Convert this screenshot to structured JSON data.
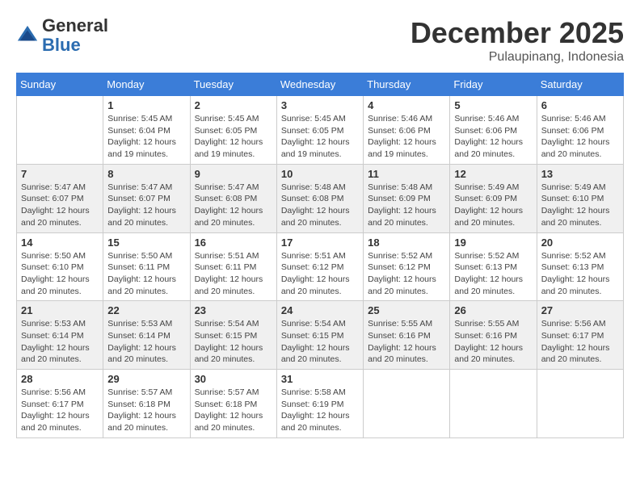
{
  "header": {
    "logo_general": "General",
    "logo_blue": "Blue",
    "month_title": "December 2025",
    "location": "Pulaupinang, Indonesia"
  },
  "days_of_week": [
    "Sunday",
    "Monday",
    "Tuesday",
    "Wednesday",
    "Thursday",
    "Friday",
    "Saturday"
  ],
  "weeks": [
    [
      {
        "day": "",
        "sunrise": "",
        "sunset": "",
        "daylight": ""
      },
      {
        "day": "1",
        "sunrise": "Sunrise: 5:45 AM",
        "sunset": "Sunset: 6:04 PM",
        "daylight": "Daylight: 12 hours and 19 minutes."
      },
      {
        "day": "2",
        "sunrise": "Sunrise: 5:45 AM",
        "sunset": "Sunset: 6:05 PM",
        "daylight": "Daylight: 12 hours and 19 minutes."
      },
      {
        "day": "3",
        "sunrise": "Sunrise: 5:45 AM",
        "sunset": "Sunset: 6:05 PM",
        "daylight": "Daylight: 12 hours and 19 minutes."
      },
      {
        "day": "4",
        "sunrise": "Sunrise: 5:46 AM",
        "sunset": "Sunset: 6:06 PM",
        "daylight": "Daylight: 12 hours and 19 minutes."
      },
      {
        "day": "5",
        "sunrise": "Sunrise: 5:46 AM",
        "sunset": "Sunset: 6:06 PM",
        "daylight": "Daylight: 12 hours and 20 minutes."
      },
      {
        "day": "6",
        "sunrise": "Sunrise: 5:46 AM",
        "sunset": "Sunset: 6:06 PM",
        "daylight": "Daylight: 12 hours and 20 minutes."
      }
    ],
    [
      {
        "day": "7",
        "sunrise": "Sunrise: 5:47 AM",
        "sunset": "Sunset: 6:07 PM",
        "daylight": "Daylight: 12 hours and 20 minutes."
      },
      {
        "day": "8",
        "sunrise": "Sunrise: 5:47 AM",
        "sunset": "Sunset: 6:07 PM",
        "daylight": "Daylight: 12 hours and 20 minutes."
      },
      {
        "day": "9",
        "sunrise": "Sunrise: 5:47 AM",
        "sunset": "Sunset: 6:08 PM",
        "daylight": "Daylight: 12 hours and 20 minutes."
      },
      {
        "day": "10",
        "sunrise": "Sunrise: 5:48 AM",
        "sunset": "Sunset: 6:08 PM",
        "daylight": "Daylight: 12 hours and 20 minutes."
      },
      {
        "day": "11",
        "sunrise": "Sunrise: 5:48 AM",
        "sunset": "Sunset: 6:09 PM",
        "daylight": "Daylight: 12 hours and 20 minutes."
      },
      {
        "day": "12",
        "sunrise": "Sunrise: 5:49 AM",
        "sunset": "Sunset: 6:09 PM",
        "daylight": "Daylight: 12 hours and 20 minutes."
      },
      {
        "day": "13",
        "sunrise": "Sunrise: 5:49 AM",
        "sunset": "Sunset: 6:10 PM",
        "daylight": "Daylight: 12 hours and 20 minutes."
      }
    ],
    [
      {
        "day": "14",
        "sunrise": "Sunrise: 5:50 AM",
        "sunset": "Sunset: 6:10 PM",
        "daylight": "Daylight: 12 hours and 20 minutes."
      },
      {
        "day": "15",
        "sunrise": "Sunrise: 5:50 AM",
        "sunset": "Sunset: 6:11 PM",
        "daylight": "Daylight: 12 hours and 20 minutes."
      },
      {
        "day": "16",
        "sunrise": "Sunrise: 5:51 AM",
        "sunset": "Sunset: 6:11 PM",
        "daylight": "Daylight: 12 hours and 20 minutes."
      },
      {
        "day": "17",
        "sunrise": "Sunrise: 5:51 AM",
        "sunset": "Sunset: 6:12 PM",
        "daylight": "Daylight: 12 hours and 20 minutes."
      },
      {
        "day": "18",
        "sunrise": "Sunrise: 5:52 AM",
        "sunset": "Sunset: 6:12 PM",
        "daylight": "Daylight: 12 hours and 20 minutes."
      },
      {
        "day": "19",
        "sunrise": "Sunrise: 5:52 AM",
        "sunset": "Sunset: 6:13 PM",
        "daylight": "Daylight: 12 hours and 20 minutes."
      },
      {
        "day": "20",
        "sunrise": "Sunrise: 5:52 AM",
        "sunset": "Sunset: 6:13 PM",
        "daylight": "Daylight: 12 hours and 20 minutes."
      }
    ],
    [
      {
        "day": "21",
        "sunrise": "Sunrise: 5:53 AM",
        "sunset": "Sunset: 6:14 PM",
        "daylight": "Daylight: 12 hours and 20 minutes."
      },
      {
        "day": "22",
        "sunrise": "Sunrise: 5:53 AM",
        "sunset": "Sunset: 6:14 PM",
        "daylight": "Daylight: 12 hours and 20 minutes."
      },
      {
        "day": "23",
        "sunrise": "Sunrise: 5:54 AM",
        "sunset": "Sunset: 6:15 PM",
        "daylight": "Daylight: 12 hours and 20 minutes."
      },
      {
        "day": "24",
        "sunrise": "Sunrise: 5:54 AM",
        "sunset": "Sunset: 6:15 PM",
        "daylight": "Daylight: 12 hours and 20 minutes."
      },
      {
        "day": "25",
        "sunrise": "Sunrise: 5:55 AM",
        "sunset": "Sunset: 6:16 PM",
        "daylight": "Daylight: 12 hours and 20 minutes."
      },
      {
        "day": "26",
        "sunrise": "Sunrise: 5:55 AM",
        "sunset": "Sunset: 6:16 PM",
        "daylight": "Daylight: 12 hours and 20 minutes."
      },
      {
        "day": "27",
        "sunrise": "Sunrise: 5:56 AM",
        "sunset": "Sunset: 6:17 PM",
        "daylight": "Daylight: 12 hours and 20 minutes."
      }
    ],
    [
      {
        "day": "28",
        "sunrise": "Sunrise: 5:56 AM",
        "sunset": "Sunset: 6:17 PM",
        "daylight": "Daylight: 12 hours and 20 minutes."
      },
      {
        "day": "29",
        "sunrise": "Sunrise: 5:57 AM",
        "sunset": "Sunset: 6:18 PM",
        "daylight": "Daylight: 12 hours and 20 minutes."
      },
      {
        "day": "30",
        "sunrise": "Sunrise: 5:57 AM",
        "sunset": "Sunset: 6:18 PM",
        "daylight": "Daylight: 12 hours and 20 minutes."
      },
      {
        "day": "31",
        "sunrise": "Sunrise: 5:58 AM",
        "sunset": "Sunset: 6:19 PM",
        "daylight": "Daylight: 12 hours and 20 minutes."
      },
      {
        "day": "",
        "sunrise": "",
        "sunset": "",
        "daylight": ""
      },
      {
        "day": "",
        "sunrise": "",
        "sunset": "",
        "daylight": ""
      },
      {
        "day": "",
        "sunrise": "",
        "sunset": "",
        "daylight": ""
      }
    ]
  ]
}
